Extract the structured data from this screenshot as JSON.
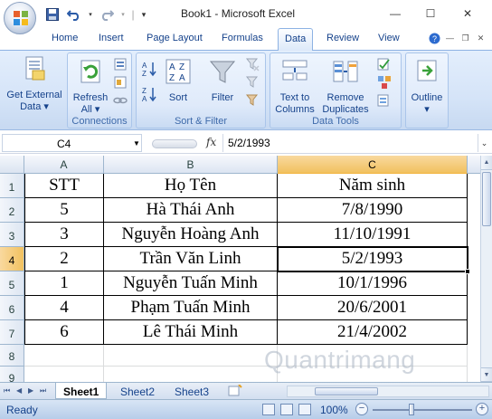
{
  "window": {
    "title": "Book1 - Microsoft Excel",
    "minimize": "—",
    "maximize": "☐",
    "close": "✕"
  },
  "ribbon_tabs": [
    "Home",
    "Insert",
    "Page Layout",
    "Formulas",
    "Data",
    "Review",
    "View"
  ],
  "active_tab": "Data",
  "ribbon": {
    "get_external_data": {
      "line1": "Get External",
      "line2": "Data ▾"
    },
    "refresh": {
      "line1": "Refresh",
      "line2": "All ▾"
    },
    "connections_label": "Connections",
    "sort_label": "Sort",
    "filter_label": "Filter",
    "sort_filter_label": "Sort & Filter",
    "text_to_columns": {
      "line1": "Text to",
      "line2": "Columns"
    },
    "remove_duplicates": {
      "line1": "Remove",
      "line2": "Duplicates"
    },
    "data_tools_label": "Data Tools",
    "outline": {
      "line1": "Outline",
      "line2": "▾"
    }
  },
  "formula_bar": {
    "name_box": "C4",
    "fx": "fx",
    "value": "5/2/1993"
  },
  "columns": [
    "A",
    "B",
    "C"
  ],
  "rows": [
    "1",
    "2",
    "3",
    "4",
    "5",
    "6",
    "7",
    "8",
    "9"
  ],
  "table": {
    "headers": [
      "STT",
      "Họ Tên",
      "Năm sinh"
    ],
    "data": [
      [
        "5",
        "Hà Thái Anh",
        "7/8/1990"
      ],
      [
        "3",
        "Nguyễn Hoàng Anh",
        "11/10/1991"
      ],
      [
        "2",
        "Trần Văn Linh",
        "5/2/1993"
      ],
      [
        "1",
        "Nguyễn Tuấn Minh",
        "10/1/1996"
      ],
      [
        "4",
        "Phạm Tuấn Minh",
        "20/6/2001"
      ],
      [
        "6",
        "Lê Thái Minh",
        "21/4/2002"
      ]
    ]
  },
  "active_cell": "C4",
  "sheets": [
    "Sheet1",
    "Sheet2",
    "Sheet3"
  ],
  "active_sheet": "Sheet1",
  "status": {
    "ready": "Ready",
    "zoom": "100%",
    "zoom_minus": "−",
    "zoom_plus": "+"
  },
  "watermark": "Quantrimang",
  "colors": {
    "ribbon_text": "#15428b",
    "selected_header": "#f1c15f",
    "grid_border": "#000000"
  }
}
